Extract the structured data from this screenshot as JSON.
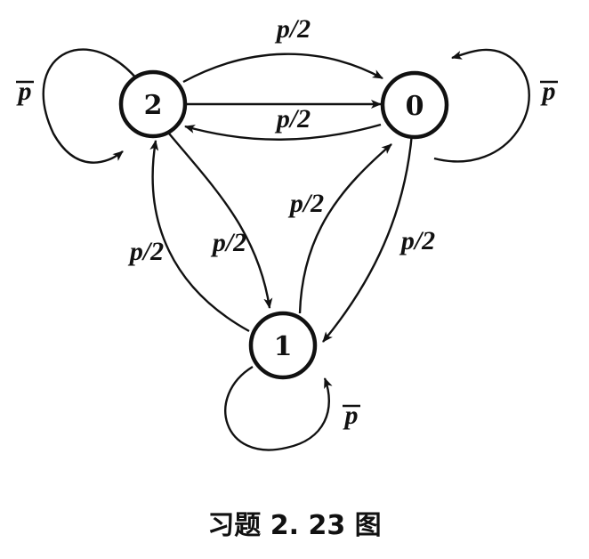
{
  "diagram": {
    "caption": "习题 2. 23 图",
    "states": [
      {
        "id": "2",
        "label": "2"
      },
      {
        "id": "0",
        "label": "0"
      },
      {
        "id": "1",
        "label": "1"
      }
    ],
    "edges": [
      {
        "from": "2",
        "to": "0",
        "label": "p/2",
        "style": "curved-top"
      },
      {
        "from": "2",
        "to": "0",
        "label": "",
        "style": "straight"
      },
      {
        "from": "0",
        "to": "2",
        "label": "p/2",
        "style": "curved-bottom"
      },
      {
        "from": "2",
        "to": "1",
        "label": "p/2",
        "style": "inner"
      },
      {
        "from": "1",
        "to": "2",
        "label": "p/2",
        "style": "outer"
      },
      {
        "from": "1",
        "to": "0",
        "label": "p/2",
        "style": "inner"
      },
      {
        "from": "0",
        "to": "1",
        "label": "p/2",
        "style": "outer"
      },
      {
        "from": "2",
        "to": "2",
        "label": "p",
        "overline": true,
        "style": "self-loop"
      },
      {
        "from": "0",
        "to": "0",
        "label": "p",
        "overline": true,
        "style": "self-loop"
      },
      {
        "from": "1",
        "to": "1",
        "label": "p",
        "overline": true,
        "style": "self-loop"
      }
    ],
    "colors": {
      "stroke": "#111111",
      "background": "#ffffff"
    }
  }
}
